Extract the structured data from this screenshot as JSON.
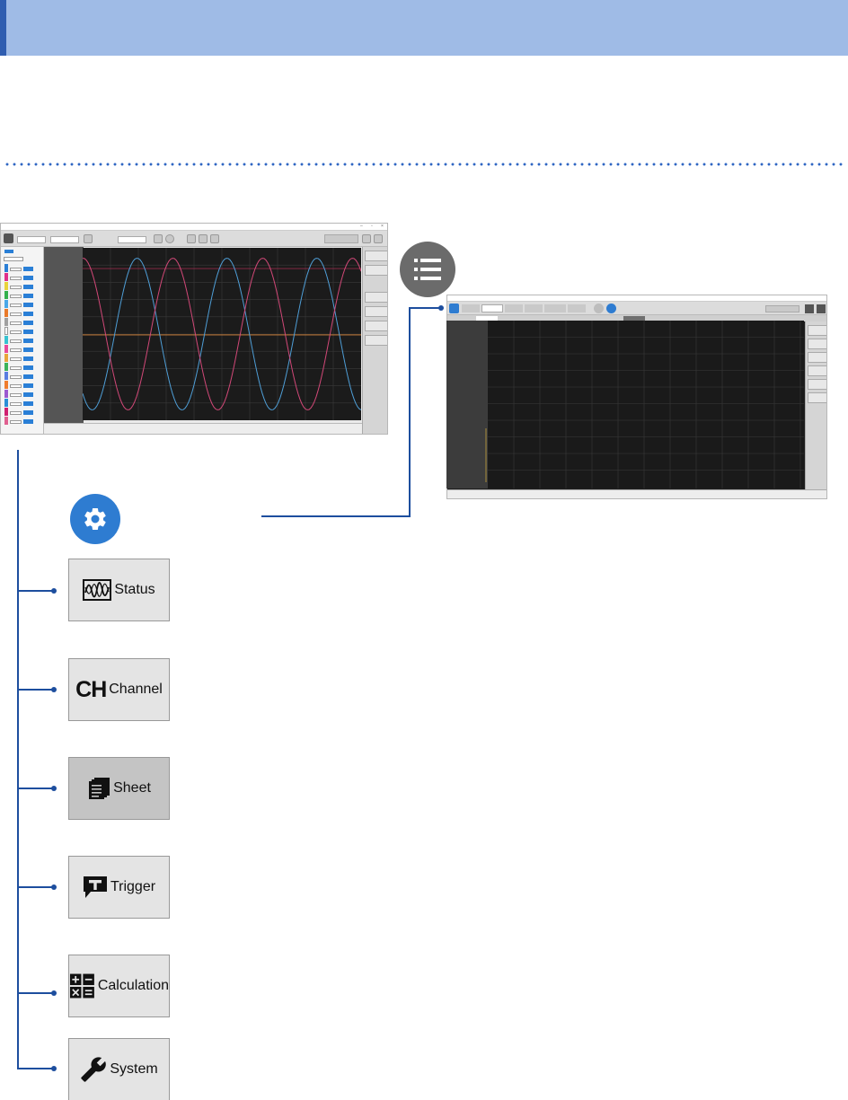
{
  "colors": {
    "header_band": "#9fbbe6",
    "header_edge": "#2f5db0",
    "connector": "#1d4e9e",
    "gear_circle": "#2e7cd1",
    "list_circle": "#6b6b6b"
  },
  "icons": {
    "settings": "gear-icon",
    "list": "list-icon",
    "status": "waveform-icon",
    "channel": "ch-glyph-icon",
    "sheet": "sheets-icon",
    "trigger": "trigger-icon",
    "calculation": "calculator-icon",
    "system": "wrench-icon"
  },
  "menu": {
    "status": "Status",
    "channel_glyph": "CH",
    "channel": "Channel",
    "sheet": "Sheet",
    "trigger": "Trigger",
    "calculation": "Calculation",
    "system": "System"
  }
}
